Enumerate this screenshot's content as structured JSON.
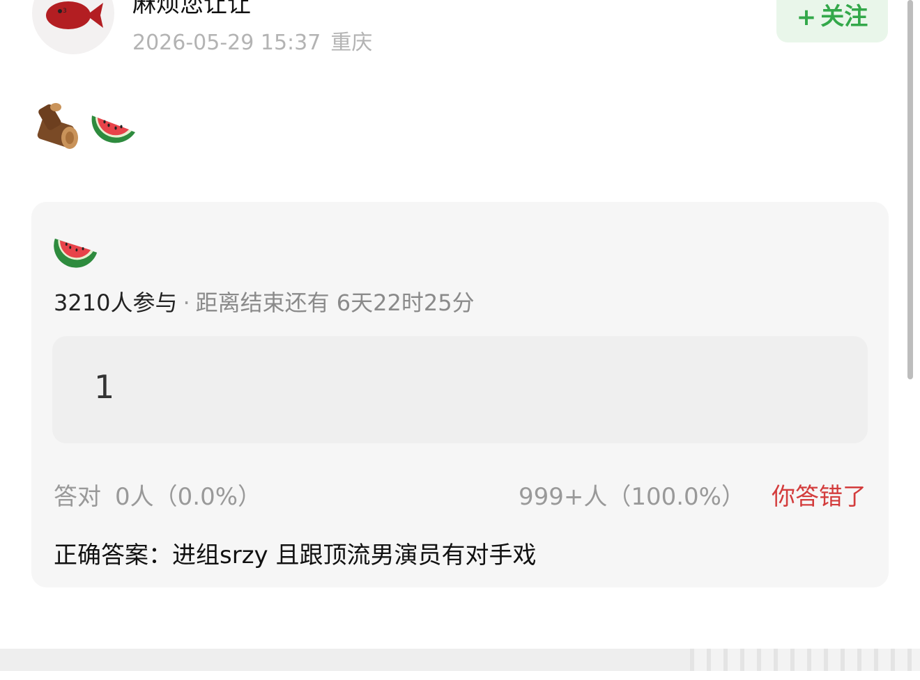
{
  "header": {
    "username": "麻烦您让让",
    "timestamp": "2026-05-29 15:37",
    "location": "重庆",
    "follow_plus": "+",
    "follow_label": "关注"
  },
  "post": {
    "emoji_icons": [
      "wood-log-icon",
      "watermelon-icon"
    ]
  },
  "poll": {
    "emoji_icon": "watermelon-icon",
    "participants": "3210人参与",
    "separator": "·",
    "time_remaining": "距离结束还有 6天22时25分",
    "option_text": "1",
    "correct_label": "答对",
    "correct_stat": "0人（0.0%）",
    "wrong_stat": "999+人（100.0%）",
    "result_text": "你答错了",
    "answer_label": "正确答案：",
    "answer_text": "进组srzy 且跟顶流男演员有对手戏"
  },
  "colors": {
    "follow_bg": "#e9f6ea",
    "follow_text": "#33a84a",
    "wrong_text": "#d33c3c",
    "card_bg": "#f6f6f6"
  }
}
